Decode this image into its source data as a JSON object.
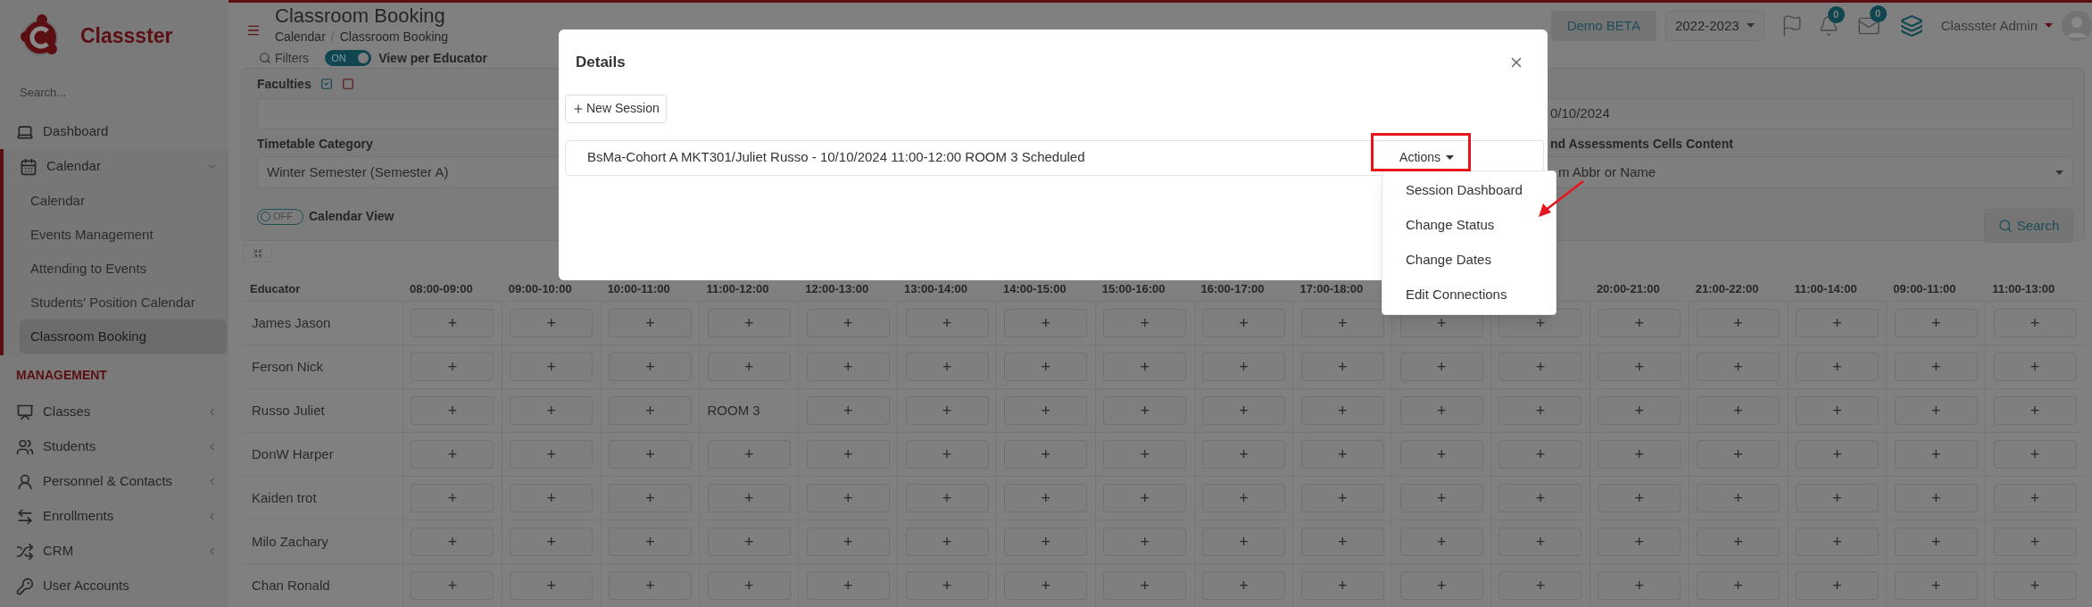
{
  "sidebar": {
    "brand": "Classster",
    "search": {
      "placeholder": "Search..."
    },
    "items": [
      {
        "kind": "link",
        "label": "Dashboard"
      },
      {
        "kind": "group",
        "label": "Calendar",
        "expanded": true,
        "children": [
          {
            "label": "Calendar",
            "selected": false
          },
          {
            "label": "Events Management",
            "selected": false
          },
          {
            "label": "Attending to Events",
            "selected": false
          },
          {
            "label": "Students' Position Calendar",
            "selected": false
          },
          {
            "label": "Classroom Booking",
            "selected": true
          }
        ]
      }
    ],
    "section": {
      "title": "MANAGEMENT",
      "items": [
        {
          "kind": "group",
          "label": "Classes",
          "expanded": false
        },
        {
          "kind": "group",
          "label": "Students",
          "expanded": false
        },
        {
          "kind": "group",
          "label": "Personnel & Contacts",
          "expanded": false
        },
        {
          "kind": "group",
          "label": "Enrollments",
          "expanded": false
        },
        {
          "kind": "group",
          "label": "CRM",
          "expanded": false
        },
        {
          "kind": "link",
          "label": "User Accounts"
        }
      ]
    }
  },
  "header": {
    "title": "Classroom Booking",
    "breadcrumb": [
      "Calendar",
      "Classroom Booking"
    ],
    "breadcrumb_separator": "/",
    "demo_button": "Demo BETA",
    "year_select": "2022-2023",
    "notifications_badge": "0",
    "messages_badge": "0",
    "user": "Classster Admin"
  },
  "filters": {
    "label": "Filters",
    "view_per_educator": {
      "label": "View per Educator",
      "on": true,
      "text": "ON"
    },
    "faculties": {
      "label": "Faculties"
    },
    "timetable_category": {
      "label": "Timetable Category",
      "value": "Winter Semester (Semester A)"
    },
    "calendar_view": {
      "label": "Calendar View",
      "on": false,
      "text": "OFF"
    },
    "date_field": {
      "value": "0/10/2024"
    },
    "cells_content": {
      "label": "nd Assessments Cells Content",
      "value": "m Abbr or Name"
    },
    "search_button": "Search"
  },
  "grid": {
    "columns": [
      {
        "label": "Educator"
      },
      {
        "label": "08:00-09:00"
      },
      {
        "label": "09:00-10:00"
      },
      {
        "label": "10:00-11:00"
      },
      {
        "label": "11:00-12:00"
      },
      {
        "label": "12:00-13:00"
      },
      {
        "label": "13:00-14:00"
      },
      {
        "label": "14:00-15:00"
      },
      {
        "label": "15:00-16:00"
      },
      {
        "label": "16:00-17:00"
      },
      {
        "label": "17:00-18:00"
      },
      {},
      {},
      {
        "label": "20:00-21:00"
      },
      {
        "label": "21:00-22:00"
      },
      {
        "label": "11:00-14:00"
      },
      {
        "label": "09:00-11:00"
      },
      {
        "label": "11:00-13:00"
      }
    ],
    "rows": [
      {
        "cells": [
          {
            "kind": "name",
            "text": "James Jason"
          },
          {
            "kind": "add",
            "text": "+"
          },
          {
            "kind": "add",
            "text": "+"
          },
          {
            "kind": "add",
            "text": "+"
          },
          {
            "kind": "add",
            "text": "+"
          },
          {
            "kind": "add",
            "text": "+"
          },
          {
            "kind": "add",
            "text": "+"
          },
          {
            "kind": "add",
            "text": "+"
          },
          {
            "kind": "add",
            "text": "+"
          },
          {
            "kind": "add",
            "text": "+"
          },
          {
            "kind": "add",
            "text": "+"
          },
          {
            "kind": "add",
            "text": "+"
          },
          {
            "kind": "add",
            "text": "+"
          },
          {
            "kind": "add",
            "text": "+"
          },
          {
            "kind": "add",
            "text": "+"
          },
          {
            "kind": "add",
            "text": "+"
          },
          {
            "kind": "add",
            "text": "+"
          },
          {
            "kind": "add",
            "text": "+"
          }
        ]
      },
      {
        "cells": [
          {
            "kind": "name",
            "text": "Ferson Nick"
          },
          {
            "kind": "add",
            "text": "+"
          },
          {
            "kind": "add",
            "text": "+"
          },
          {
            "kind": "add",
            "text": "+"
          },
          {
            "kind": "add",
            "text": "+"
          },
          {
            "kind": "add",
            "text": "+"
          },
          {
            "kind": "add",
            "text": "+"
          },
          {
            "kind": "add",
            "text": "+"
          },
          {
            "kind": "add",
            "text": "+"
          },
          {
            "kind": "add",
            "text": "+"
          },
          {
            "kind": "add",
            "text": "+"
          },
          {
            "kind": "add",
            "text": "+"
          },
          {
            "kind": "add",
            "text": "+"
          },
          {
            "kind": "add",
            "text": "+"
          },
          {
            "kind": "add",
            "text": "+"
          },
          {
            "kind": "add",
            "text": "+"
          },
          {
            "kind": "add",
            "text": "+"
          },
          {
            "kind": "add",
            "text": "+"
          }
        ]
      },
      {
        "cells": [
          {
            "kind": "name",
            "text": "Russo Juliet"
          },
          {
            "kind": "add",
            "text": "+"
          },
          {
            "kind": "add",
            "text": "+"
          },
          {
            "kind": "add",
            "text": "+"
          },
          {
            "kind": "booking",
            "text": "ROOM 3"
          },
          {
            "kind": "add",
            "text": "+"
          },
          {
            "kind": "add",
            "text": "+"
          },
          {
            "kind": "add",
            "text": "+"
          },
          {
            "kind": "add",
            "text": "+"
          },
          {
            "kind": "add",
            "text": "+"
          },
          {
            "kind": "add",
            "text": "+"
          },
          {
            "kind": "add",
            "text": "+"
          },
          {
            "kind": "add",
            "text": "+"
          },
          {
            "kind": "add",
            "text": "+"
          },
          {
            "kind": "add",
            "text": "+"
          },
          {
            "kind": "add",
            "text": "+"
          },
          {
            "kind": "add",
            "text": "+"
          },
          {
            "kind": "add",
            "text": "+"
          }
        ]
      },
      {
        "cells": [
          {
            "kind": "name",
            "text": "DonW Harper"
          },
          {
            "kind": "add",
            "text": "+"
          },
          {
            "kind": "add",
            "text": "+"
          },
          {
            "kind": "add",
            "text": "+"
          },
          {
            "kind": "add",
            "text": "+"
          },
          {
            "kind": "add",
            "text": "+"
          },
          {
            "kind": "add",
            "text": "+"
          },
          {
            "kind": "add",
            "text": "+"
          },
          {
            "kind": "add",
            "text": "+"
          },
          {
            "kind": "add",
            "text": "+"
          },
          {
            "kind": "add",
            "text": "+"
          },
          {
            "kind": "add",
            "text": "+"
          },
          {
            "kind": "add",
            "text": "+"
          },
          {
            "kind": "add",
            "text": "+"
          },
          {
            "kind": "add",
            "text": "+"
          },
          {
            "kind": "add",
            "text": "+"
          },
          {
            "kind": "add",
            "text": "+"
          },
          {
            "kind": "add",
            "text": "+"
          }
        ]
      },
      {
        "cells": [
          {
            "kind": "name",
            "text": "Kaiden trot"
          },
          {
            "kind": "add",
            "text": "+"
          },
          {
            "kind": "add",
            "text": "+"
          },
          {
            "kind": "add",
            "text": "+"
          },
          {
            "kind": "add",
            "text": "+"
          },
          {
            "kind": "add",
            "text": "+"
          },
          {
            "kind": "add",
            "text": "+"
          },
          {
            "kind": "add",
            "text": "+"
          },
          {
            "kind": "add",
            "text": "+"
          },
          {
            "kind": "add",
            "text": "+"
          },
          {
            "kind": "add",
            "text": "+"
          },
          {
            "kind": "add",
            "text": "+"
          },
          {
            "kind": "add",
            "text": "+"
          },
          {
            "kind": "add",
            "text": "+"
          },
          {
            "kind": "add",
            "text": "+"
          },
          {
            "kind": "add",
            "text": "+"
          },
          {
            "kind": "add",
            "text": "+"
          },
          {
            "kind": "add",
            "text": "+"
          }
        ]
      },
      {
        "cells": [
          {
            "kind": "name",
            "text": "Milo Zachary"
          },
          {
            "kind": "add",
            "text": "+"
          },
          {
            "kind": "add",
            "text": "+"
          },
          {
            "kind": "add",
            "text": "+"
          },
          {
            "kind": "add",
            "text": "+"
          },
          {
            "kind": "add",
            "text": "+"
          },
          {
            "kind": "add",
            "text": "+"
          },
          {
            "kind": "add",
            "text": "+"
          },
          {
            "kind": "add",
            "text": "+"
          },
          {
            "kind": "add",
            "text": "+"
          },
          {
            "kind": "add",
            "text": "+"
          },
          {
            "kind": "add",
            "text": "+"
          },
          {
            "kind": "add",
            "text": "+"
          },
          {
            "kind": "add",
            "text": "+"
          },
          {
            "kind": "add",
            "text": "+"
          },
          {
            "kind": "add",
            "text": "+"
          },
          {
            "kind": "add",
            "text": "+"
          },
          {
            "kind": "add",
            "text": "+"
          }
        ]
      },
      {
        "cells": [
          {
            "kind": "name",
            "text": "Chan Ronald"
          },
          {
            "kind": "add",
            "text": "+"
          },
          {
            "kind": "add",
            "text": "+"
          },
          {
            "kind": "add",
            "text": "+"
          },
          {
            "kind": "add",
            "text": "+"
          },
          {
            "kind": "add",
            "text": "+"
          },
          {
            "kind": "add",
            "text": "+"
          },
          {
            "kind": "add",
            "text": "+"
          },
          {
            "kind": "add",
            "text": "+"
          },
          {
            "kind": "add",
            "text": "+"
          },
          {
            "kind": "add",
            "text": "+"
          },
          {
            "kind": "add",
            "text": "+"
          },
          {
            "kind": "add",
            "text": "+"
          },
          {
            "kind": "add",
            "text": "+"
          },
          {
            "kind": "add",
            "text": "+"
          },
          {
            "kind": "add",
            "text": "+"
          },
          {
            "kind": "add",
            "text": "+"
          },
          {
            "kind": "add",
            "text": "+"
          }
        ]
      }
    ]
  },
  "modal": {
    "title": "Details",
    "new_session_button": "New Session",
    "sessions": [
      {
        "text": "BsMa-Cohort A MKT301/Juliet Russo - 10/10/2024 11:00-12:00 ROOM 3 Scheduled",
        "actions_button": "Actions",
        "expanded": true
      }
    ],
    "actions_menu": [
      "Session Dashboard",
      "Change Status",
      "Change Dates",
      "Edit Connections"
    ]
  }
}
